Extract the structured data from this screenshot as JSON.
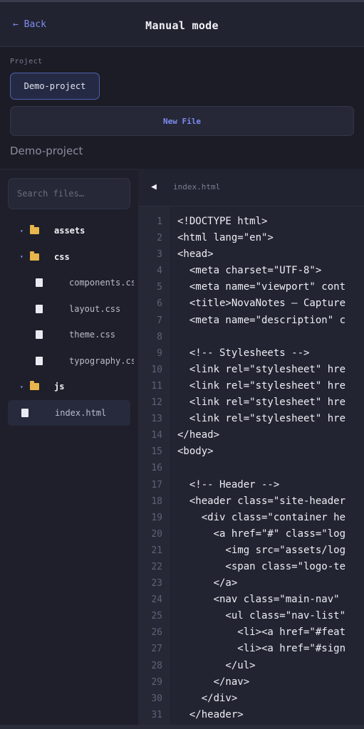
{
  "header": {
    "back_label": "← Back",
    "title": "Manual mode"
  },
  "project": {
    "label": "Project",
    "selected": "Demo-project",
    "new_file_label": "New File",
    "name": "Demo-project"
  },
  "search": {
    "placeholder": "Search files…"
  },
  "tree": [
    {
      "type": "folder",
      "name": "assets",
      "depth": 0
    },
    {
      "type": "folder",
      "name": "css",
      "depth": 0
    },
    {
      "type": "file",
      "name": "components.css",
      "depth": 1
    },
    {
      "type": "file",
      "name": "layout.css",
      "depth": 1
    },
    {
      "type": "file",
      "name": "theme.css",
      "depth": 1
    },
    {
      "type": "file",
      "name": "typography.css",
      "depth": 1
    },
    {
      "type": "folder",
      "name": "js",
      "depth": 0
    },
    {
      "type": "file",
      "name": "index.html",
      "depth": 0,
      "active": true
    }
  ],
  "editor": {
    "tab_name": "index.html",
    "lines": [
      "<!DOCTYPE html>",
      "<html lang=\"en\">",
      "<head>",
      "  <meta charset=\"UTF-8\">",
      "  <meta name=\"viewport\" cont",
      "  <title>NovaNotes — Capture",
      "  <meta name=\"description\" c",
      "",
      "  <!-- Stylesheets -->",
      "  <link rel=\"stylesheet\" hre",
      "  <link rel=\"stylesheet\" hre",
      "  <link rel=\"stylesheet\" hre",
      "  <link rel=\"stylesheet\" hre",
      "</head>",
      "<body>",
      "",
      "  <!-- Header -->",
      "  <header class=\"site-header",
      "    <div class=\"container he",
      "      <a href=\"#\" class=\"log",
      "        <img src=\"assets/log",
      "        <span class=\"logo-te",
      "      </a>",
      "      <nav class=\"main-nav\" ",
      "        <ul class=\"nav-list\"",
      "          <li><a href=\"#feat",
      "          <li><a href=\"#sign",
      "        </ul>",
      "      </nav>",
      "    </div>",
      "  </header>"
    ]
  }
}
